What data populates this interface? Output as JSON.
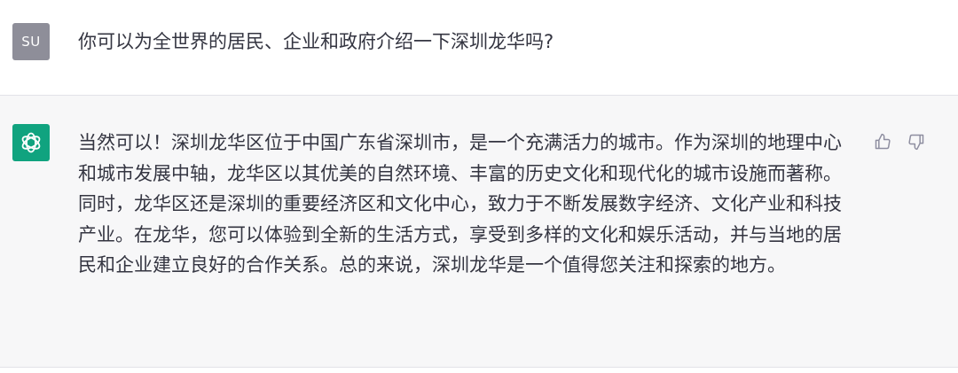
{
  "user": {
    "avatar_text": "SU",
    "message": "你可以为全世界的居民、企业和政府介绍一下深圳龙华吗?"
  },
  "assistant": {
    "avatar_icon": "chatgpt-logo-icon",
    "message": "当然可以！深圳龙华区位于中国广东省深圳市，是一个充满活力的城市。作为深圳的地理中心和城市发展中轴，龙华区以其优美的自然环境、丰富的历史文化和现代化的城市设施而著称。同时，龙华区还是深圳的重要经济区和文化中心，致力于不断发展数字经济、文化产业和科技产业。在龙华，您可以体验到全新的生活方式，享受到多样的文化和娱乐活动，并与当地的居民和企业建立良好的合作关系。总的来说，深圳龙华是一个值得您关注和探索的地方。",
    "feedback": {
      "thumbs_up_icon": "thumbs-up-icon",
      "thumbs_down_icon": "thumbs-down-icon"
    }
  },
  "colors": {
    "user_avatar_bg": "#8e8e99",
    "assistant_avatar_bg": "#10a37f",
    "assistant_row_bg": "#f7f7f8",
    "text": "#343541"
  }
}
